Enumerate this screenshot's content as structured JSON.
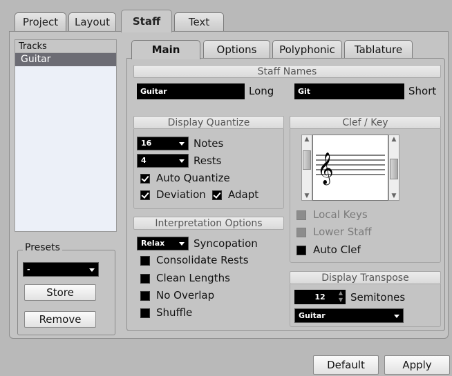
{
  "top_tabs": [
    "Project",
    "Layout",
    "Staff",
    "Text"
  ],
  "tracks": {
    "header": "Tracks",
    "items": [
      "Guitar"
    ]
  },
  "presets": {
    "label": "Presets",
    "value": "-",
    "store": "Store",
    "remove": "Remove"
  },
  "inner_tabs": [
    "Main",
    "Options",
    "Polyphonic",
    "Tablature"
  ],
  "staff_names": {
    "title": "Staff Names",
    "long_value": "Guitar",
    "long_label": "Long",
    "short_value": "Git",
    "short_label": "Short"
  },
  "display_quantize": {
    "title": "Display Quantize",
    "notes_value": "16",
    "notes_label": "Notes",
    "rests_value": "4",
    "rests_label": "Rests",
    "auto_quantize": "Auto Quantize",
    "deviation": "Deviation",
    "adapt": "Adapt"
  },
  "interpretation": {
    "title": "Interpretation Options",
    "syncopation_value": "Relax",
    "syncopation_label": "Syncopation",
    "consolidate_rests": "Consolidate Rests",
    "clean_lengths": "Clean Lengths",
    "no_overlap": "No Overlap",
    "shuffle": "Shuffle"
  },
  "clef_key": {
    "title": "Clef / Key",
    "clef_icon": "treble-clef-icon",
    "local_keys": "Local Keys",
    "lower_staff": "Lower Staff",
    "auto_clef": "Auto Clef"
  },
  "display_transpose": {
    "title": "Display Transpose",
    "semitones_value": "12",
    "semitones_label": "Semitones",
    "instrument_value": "Guitar"
  },
  "footer": {
    "default": "Default",
    "apply": "Apply"
  }
}
